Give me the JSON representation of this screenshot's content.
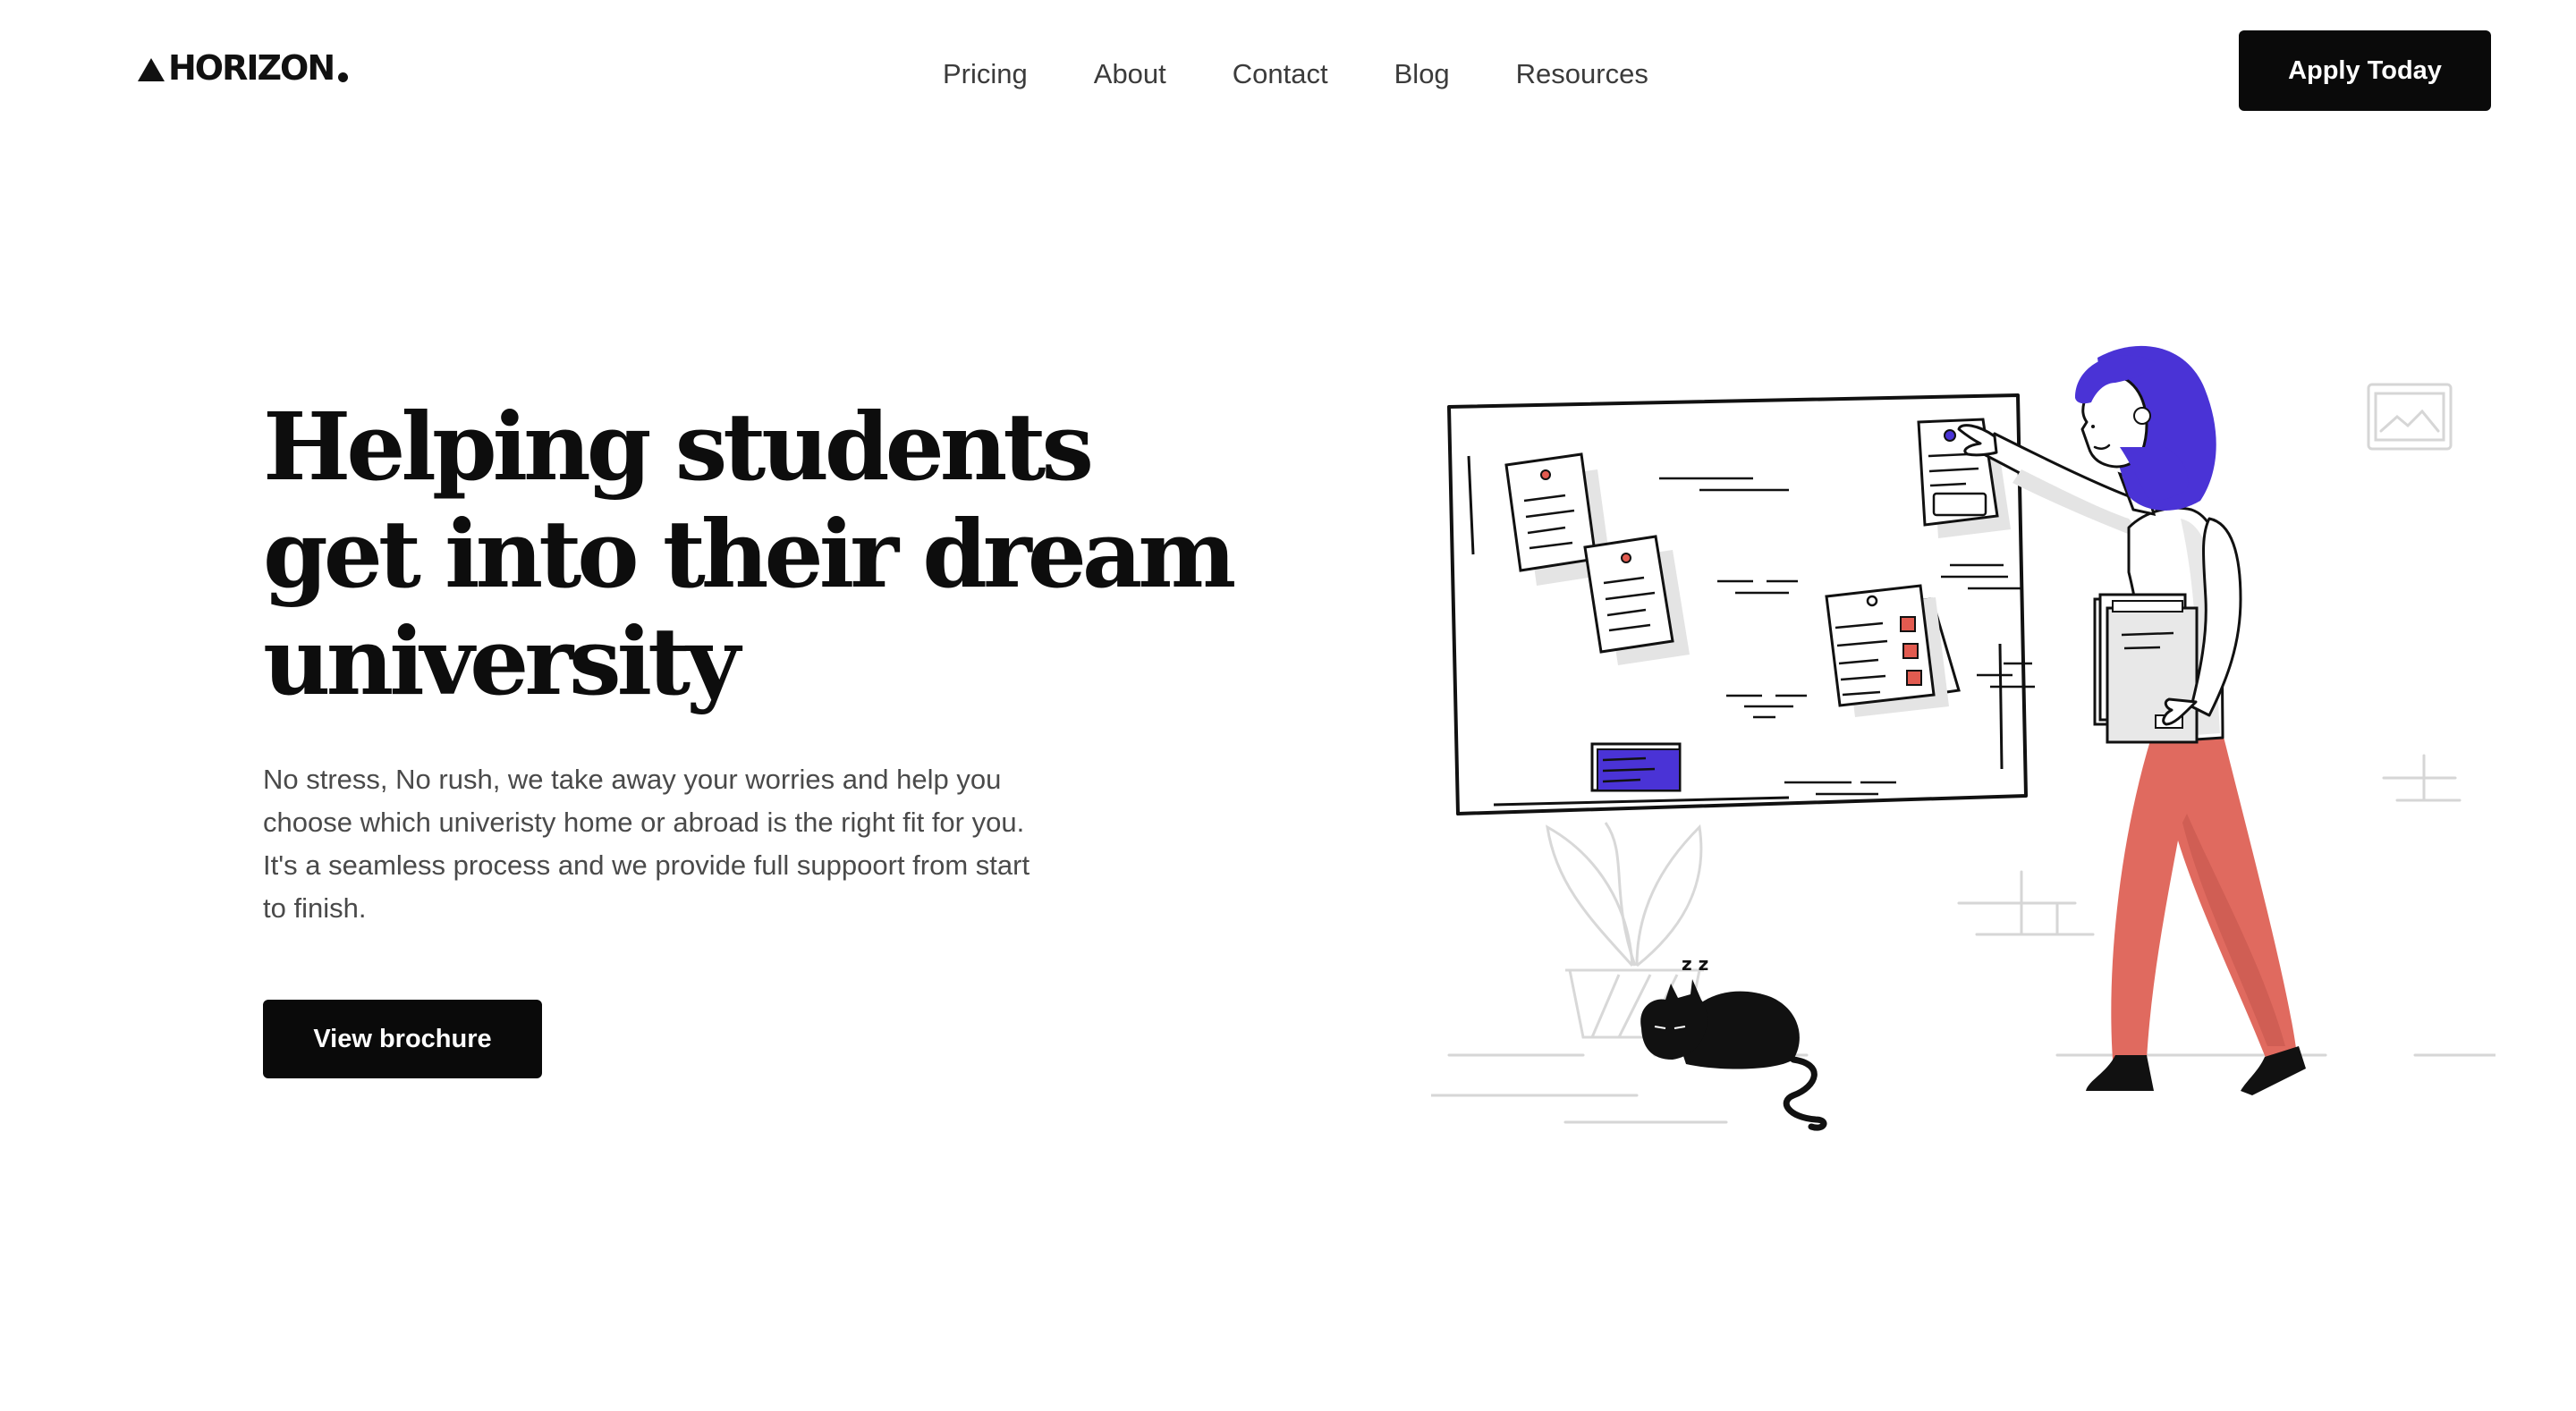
{
  "brand": {
    "name": "HORIZON"
  },
  "nav": {
    "items": [
      {
        "label": "Pricing"
      },
      {
        "label": "About"
      },
      {
        "label": "Contact"
      },
      {
        "label": "Blog"
      },
      {
        "label": "Resources"
      }
    ],
    "cta_label": "Apply Today"
  },
  "hero": {
    "title_lines": [
      "Helping students",
      "get into their dream",
      "university"
    ],
    "body_lines": [
      "No stress, No rush, we take away your worries and help you",
      "choose which univeristy home or abroad is the right fit for you.",
      "It's a seamless process and we provide full suppoort from start",
      "to finish."
    ],
    "cta_label": "View brochure"
  },
  "colors": {
    "accent_blue": "#4a33d6",
    "pants_coral": "#e06a5f",
    "button_black": "#0a0a0a"
  },
  "icons": [
    "logo-triangle-icon",
    "logo-dot-icon"
  ]
}
